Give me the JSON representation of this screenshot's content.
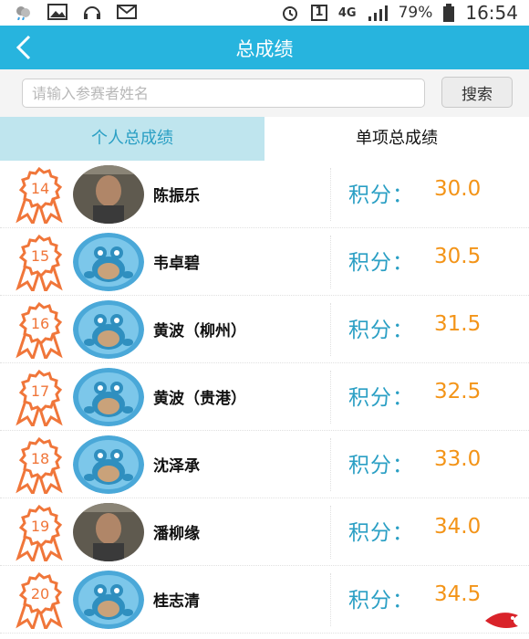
{
  "status_bar": {
    "icons_left": [
      "weather-icon",
      "gallery-icon",
      "headset-icon",
      "mail-icon"
    ],
    "sim_slot": "1",
    "network": "4G",
    "battery": "79%",
    "time": "16:54"
  },
  "header": {
    "title": "总成绩"
  },
  "search": {
    "placeholder": "请输入参赛者姓名",
    "button_label": "搜索"
  },
  "tabs": [
    {
      "label": "个人总成绩",
      "active": true
    },
    {
      "label": "单项总成绩",
      "active": false
    }
  ],
  "score_prefix": "积分：",
  "rows": [
    {
      "rank": "14",
      "name": "陈振乐",
      "score": "30.0",
      "avatar": "photo"
    },
    {
      "rank": "15",
      "name": "韦卓碧",
      "score": "30.5",
      "avatar": "default"
    },
    {
      "rank": "16",
      "name": "黄波（柳州）",
      "score": "31.5",
      "avatar": "default"
    },
    {
      "rank": "17",
      "name": "黄波（贵港）",
      "score": "32.5",
      "avatar": "default"
    },
    {
      "rank": "18",
      "name": "沈泽承",
      "score": "33.0",
      "avatar": "default"
    },
    {
      "rank": "19",
      "name": "潘柳缘",
      "score": "34.0",
      "avatar": "photo"
    },
    {
      "rank": "20",
      "name": "桂志清",
      "score": "34.5",
      "avatar": "default"
    }
  ],
  "colors": {
    "accent": "#27b4de",
    "score": "#f39418",
    "ribbon": "#f0763a",
    "tab_active_bg": "#bfe5ee"
  }
}
